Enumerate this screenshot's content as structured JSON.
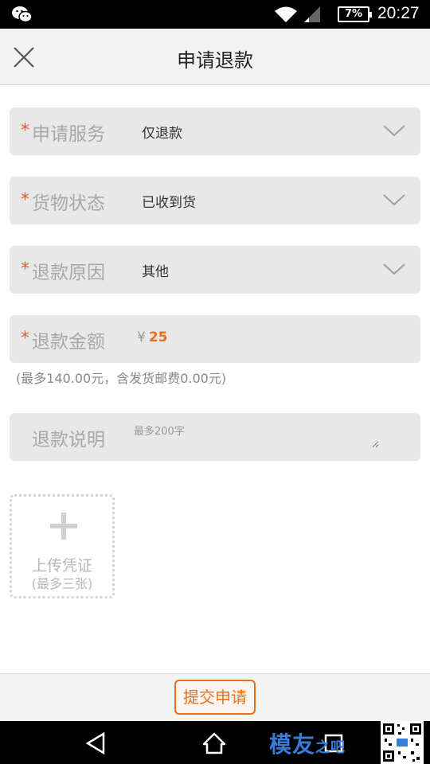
{
  "status_bar": {
    "battery": "7%",
    "time": "20:27",
    "icons": [
      "wechat-icon",
      "wifi-icon",
      "signal-icon",
      "battery-icon"
    ]
  },
  "header": {
    "title": "申请退款",
    "close_icon": "close-icon"
  },
  "form": {
    "service": {
      "required": "*",
      "label": "申请服务",
      "value": "仅退款"
    },
    "goods_status": {
      "required": "*",
      "label": "货物状态",
      "value": "已收到货"
    },
    "reason": {
      "required": "*",
      "label": "退款原因",
      "value": "其他"
    },
    "amount": {
      "required": "*",
      "label": "退款金额",
      "currency": "¥",
      "value": "25"
    },
    "amount_hint": "(最多140.00元，含发货邮费0.00元)",
    "description": {
      "label": "退款说明",
      "placeholder": "最多200字"
    }
  },
  "upload": {
    "label": "上传凭证",
    "sublabel": "(最多三张)"
  },
  "footer": {
    "submit_label": "提交申请"
  },
  "watermark": {
    "text": "模友",
    "sub": "之吧"
  },
  "colors": {
    "accent": "#e8701a",
    "required_star": "#e85a3a",
    "field_bg": "#e8e8e8",
    "header_bg": "#f2f2f2"
  }
}
